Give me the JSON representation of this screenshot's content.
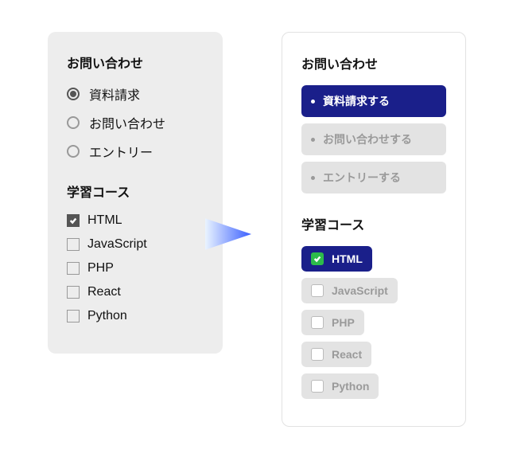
{
  "left": {
    "inquiry": {
      "heading": "お問い合わせ",
      "options": [
        {
          "label": "資料請求",
          "selected": true
        },
        {
          "label": "お問い合わせ",
          "selected": false
        },
        {
          "label": "エントリー",
          "selected": false
        }
      ]
    },
    "courses": {
      "heading": "学習コース",
      "items": [
        {
          "label": "HTML",
          "selected": true
        },
        {
          "label": "JavaScript",
          "selected": false
        },
        {
          "label": "PHP",
          "selected": false
        },
        {
          "label": "React",
          "selected": false
        },
        {
          "label": "Python",
          "selected": false
        }
      ]
    }
  },
  "right": {
    "inquiry": {
      "heading": "お問い合わせ",
      "options": [
        {
          "label": "資料請求する",
          "selected": true
        },
        {
          "label": "お問い合わせする",
          "selected": false
        },
        {
          "label": "エントリーする",
          "selected": false
        }
      ]
    },
    "courses": {
      "heading": "学習コース",
      "items": [
        {
          "label": "HTML",
          "selected": true
        },
        {
          "label": "JavaScript",
          "selected": false
        },
        {
          "label": "PHP",
          "selected": false
        },
        {
          "label": "React",
          "selected": false
        },
        {
          "label": "Python",
          "selected": false
        }
      ]
    }
  },
  "colors": {
    "accent": "#1a1f8a",
    "check_green": "#2dbb4b"
  }
}
